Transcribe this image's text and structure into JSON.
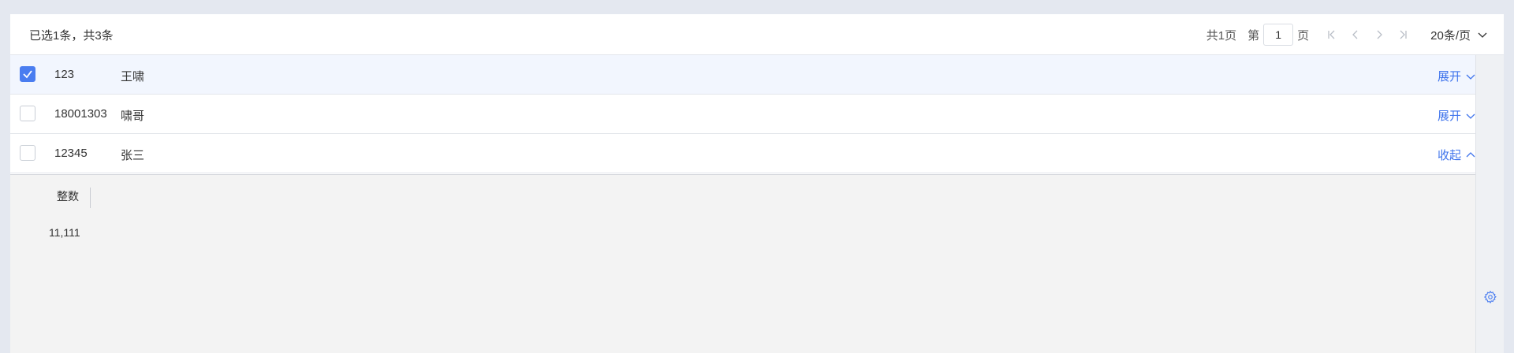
{
  "toolbar": {
    "selection_info": "已选1条，共3条"
  },
  "pagination": {
    "total_pages_label": "共1页",
    "page_prefix": "第",
    "current_page": "1",
    "page_suffix": "页",
    "page_size_label": "20条/页"
  },
  "rows": [
    {
      "id": "123",
      "name": "王啸",
      "toggle": "展开",
      "checked": true
    },
    {
      "id": "18001303",
      "name": "啸哥",
      "toggle": "展开",
      "checked": false
    },
    {
      "id": "12345",
      "name": "张三",
      "toggle": "收起",
      "checked": false
    }
  ],
  "detail": {
    "field_label": "整数",
    "field_value": "11,111"
  },
  "colors": {
    "accent": "#4a7df0",
    "link": "#3f74ec",
    "selected_row": "#f2f6fe"
  },
  "icons": [
    "check-icon",
    "first-page-icon",
    "prev-page-icon",
    "next-page-icon",
    "last-page-icon",
    "chevron-down-icon",
    "chevron-up-icon",
    "gear-icon"
  ]
}
